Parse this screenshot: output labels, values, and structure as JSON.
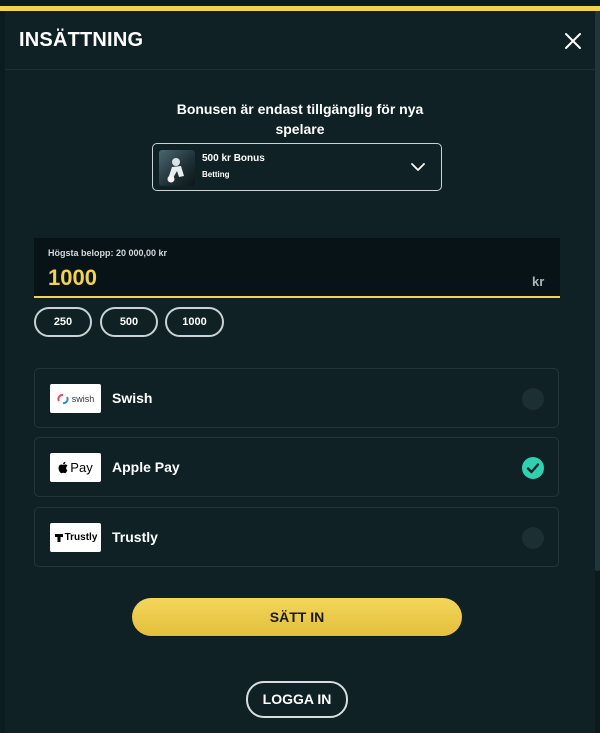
{
  "header": {
    "title": "INSÄTTNING"
  },
  "bonus": {
    "notice": "Bonusen är endast tillgänglig för nya spelare",
    "selected_name": "500 kr Bonus",
    "selected_category": "Betting"
  },
  "amount": {
    "label": "Högsta belopp: 20 000,00 kr",
    "value": "1000",
    "currency": "kr",
    "quick_options": [
      "250",
      "500",
      "1000"
    ]
  },
  "payment_methods": [
    {
      "name": "Swish",
      "logo_text": "swish",
      "selected": false
    },
    {
      "name": "Apple Pay",
      "logo_text": "Pay",
      "selected": true
    },
    {
      "name": "Trustly",
      "logo_text": "Trustly",
      "selected": false
    }
  ],
  "actions": {
    "deposit_label": "SÄTT IN",
    "login_label": "LOGGA IN"
  },
  "colors": {
    "accent": "#f2d34b",
    "check": "#2ed1b1",
    "background": "#0f2124"
  }
}
